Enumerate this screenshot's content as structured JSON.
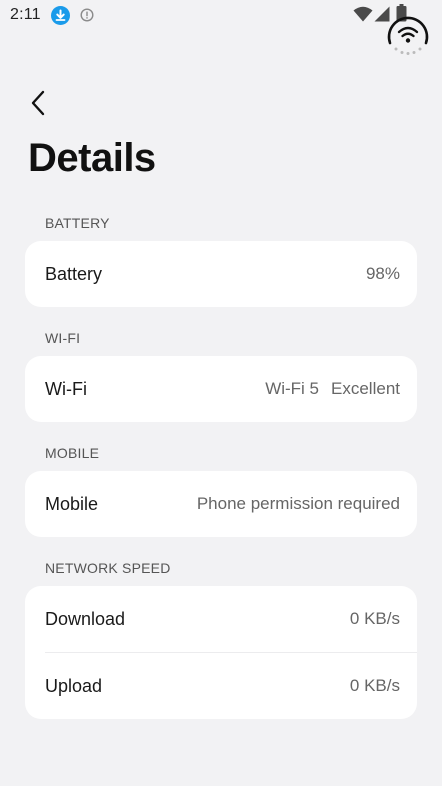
{
  "status_bar": {
    "time": "2:11",
    "icons": [
      "download-icon",
      "info-icon",
      "wifi-icon",
      "cellular-icon",
      "battery-icon"
    ]
  },
  "floating_icon": "wifi-icon",
  "header": {
    "back_icon": "back-arrow-icon",
    "title": "Details"
  },
  "sections": {
    "battery": {
      "header": "BATTERY",
      "label": "Battery",
      "value": "98%"
    },
    "wifi": {
      "header": "WI-FI",
      "label": "Wi-Fi",
      "standard": "Wi-Fi 5",
      "quality": "Excellent"
    },
    "mobile": {
      "header": "MOBILE",
      "label": "Mobile",
      "value": "Phone permission required"
    },
    "network_speed": {
      "header": "NETWORK SPEED",
      "download_label": "Download",
      "download_value": "0 KB/s",
      "upload_label": "Upload",
      "upload_value": "0 KB/s"
    }
  },
  "colors": {
    "background": "#f2f2f4",
    "card": "#ffffff",
    "accent": "#1a9bea"
  }
}
